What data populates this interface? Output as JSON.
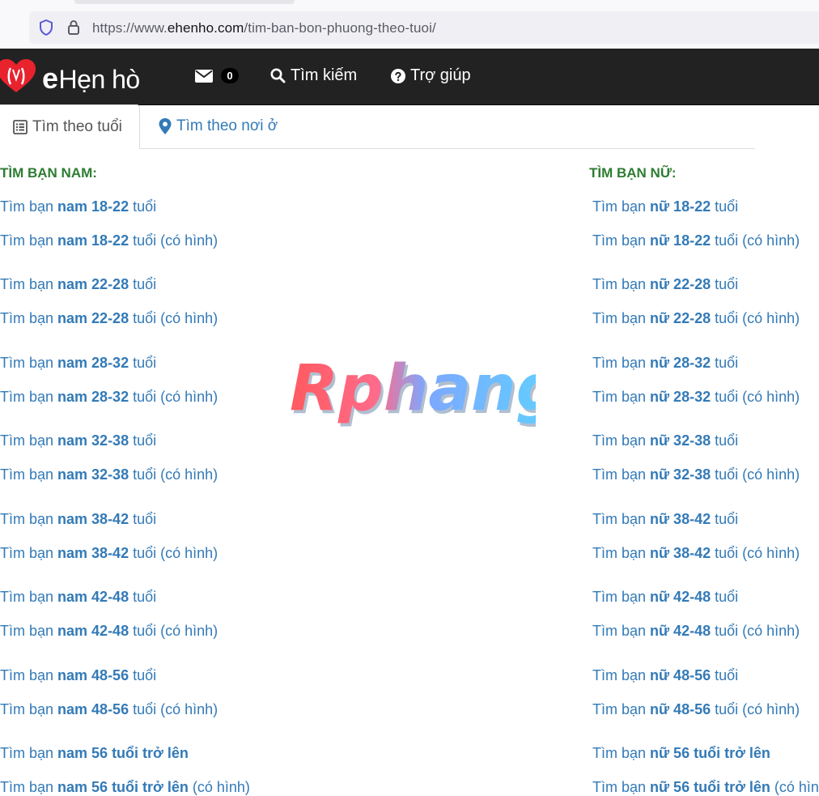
{
  "browser": {
    "url_prefix": "https://www.",
    "url_domain": "ehenho.com",
    "url_path": "/tim-ban-bon-phuong-theo-tuoi/"
  },
  "navbar": {
    "logo_e": "e",
    "logo_rest": "Hẹn hò",
    "messages_count": "0",
    "search_label": "Tìm kiếm",
    "help_label": "Trợ giúp"
  },
  "tabs": {
    "by_age": "Tìm theo tuổi",
    "by_location": "Tìm theo nơi ở"
  },
  "watermark": "Rphang",
  "left": {
    "heading": "TÌM BẠN NAM:",
    "items": [
      {
        "pre": "Tìm bạn ",
        "bold": "nam 18-22",
        "post": " tuổi"
      },
      {
        "pre": "Tìm bạn ",
        "bold": "nam 18-22",
        "post": " tuổi (có hình)"
      },
      {
        "pre": "Tìm bạn ",
        "bold": "nam 22-28",
        "post": " tuổi"
      },
      {
        "pre": "Tìm bạn ",
        "bold": "nam 22-28",
        "post": " tuổi (có hình)"
      },
      {
        "pre": "Tìm bạn ",
        "bold": "nam 28-32",
        "post": " tuổi"
      },
      {
        "pre": "Tìm bạn ",
        "bold": "nam 28-32",
        "post": " tuổi (có hình)"
      },
      {
        "pre": "Tìm bạn ",
        "bold": "nam 32-38",
        "post": " tuổi"
      },
      {
        "pre": "Tìm bạn ",
        "bold": "nam 32-38",
        "post": " tuổi (có hình)"
      },
      {
        "pre": "Tìm bạn ",
        "bold": "nam 38-42",
        "post": " tuổi"
      },
      {
        "pre": "Tìm bạn ",
        "bold": "nam 38-42",
        "post": " tuổi (có hình)"
      },
      {
        "pre": "Tìm bạn ",
        "bold": "nam 42-48",
        "post": " tuổi"
      },
      {
        "pre": "Tìm bạn ",
        "bold": "nam 42-48",
        "post": " tuổi (có hình)"
      },
      {
        "pre": "Tìm bạn ",
        "bold": "nam 48-56",
        "post": " tuổi"
      },
      {
        "pre": "Tìm bạn ",
        "bold": "nam 48-56",
        "post": " tuổi (có hình)"
      },
      {
        "pre": "Tìm bạn ",
        "bold": "nam 56 tuổi trở lên",
        "post": ""
      },
      {
        "pre": "Tìm bạn ",
        "bold": "nam 56 tuổi trở lên",
        "post": " (có hình)"
      }
    ]
  },
  "right": {
    "heading": "TÌM BẠN NỮ:",
    "items": [
      {
        "pre": "Tìm bạn ",
        "bold": "nữ 18-22",
        "post": " tuổi"
      },
      {
        "pre": "Tìm bạn ",
        "bold": "nữ 18-22",
        "post": " tuổi (có hình)"
      },
      {
        "pre": "Tìm bạn ",
        "bold": "nữ 22-28",
        "post": " tuổi"
      },
      {
        "pre": "Tìm bạn ",
        "bold": "nữ 22-28",
        "post": " tuổi (có hình)"
      },
      {
        "pre": "Tìm bạn ",
        "bold": "nữ 28-32",
        "post": " tuổi"
      },
      {
        "pre": "Tìm bạn ",
        "bold": "nữ 28-32",
        "post": " tuổi (có hình)"
      },
      {
        "pre": "Tìm bạn ",
        "bold": "nữ 32-38",
        "post": " tuổi"
      },
      {
        "pre": "Tìm bạn ",
        "bold": "nữ 32-38",
        "post": " tuổi (có hình)"
      },
      {
        "pre": "Tìm bạn ",
        "bold": "nữ 38-42",
        "post": " tuổi"
      },
      {
        "pre": "Tìm bạn ",
        "bold": "nữ 38-42",
        "post": " tuổi (có hình)"
      },
      {
        "pre": "Tìm bạn ",
        "bold": "nữ 42-48",
        "post": " tuổi"
      },
      {
        "pre": "Tìm bạn ",
        "bold": "nữ 42-48",
        "post": " tuổi (có hình)"
      },
      {
        "pre": "Tìm bạn ",
        "bold": "nữ 48-56",
        "post": " tuổi"
      },
      {
        "pre": "Tìm bạn ",
        "bold": "nữ 48-56",
        "post": " tuổi (có hình)"
      },
      {
        "pre": "Tìm bạn ",
        "bold": "nữ 56 tuổi trở lên",
        "post": ""
      },
      {
        "pre": "Tìm bạn ",
        "bold": "nữ 56 tuổi trở lên",
        "post": " (có hình)"
      }
    ]
  }
}
